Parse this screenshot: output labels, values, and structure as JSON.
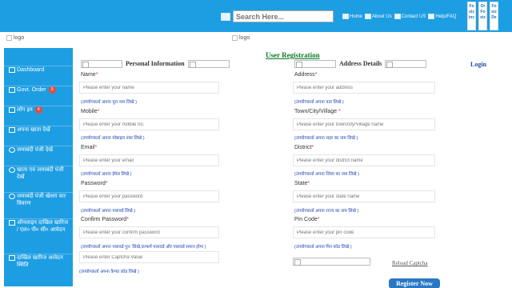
{
  "header": {
    "search_placeholder": "Search Here...",
    "links": [
      "Home",
      "About Us",
      "Contact US",
      "Help/FAQ"
    ],
    "side_tabs": [
      "Fo\nsiz\ninc",
      "Or\nFo\nsiz",
      "Fo\nsiz\nDe"
    ],
    "logo_alt_left": "logo",
    "logo_alt_center": "logo"
  },
  "sidebar": {
    "items": [
      {
        "label": "Dashboard",
        "badge": null,
        "icon": "dashboard-icon"
      },
      {
        "label": "Govt. Order",
        "badge": "3",
        "icon": "document-icon"
      },
      {
        "label": "लॉग इन",
        "badge": "4",
        "icon": "list-icon"
      },
      {
        "label": "अपना खाता देखें",
        "badge": null,
        "icon": "list-icon"
      },
      {
        "label": "जमाबंदी पंजी देखें",
        "badge": null,
        "icon": "eye-icon"
      },
      {
        "label": "खाता एवं जमाबंदी पंजी देखें",
        "badge": null,
        "icon": "eye-icon"
      },
      {
        "label": "जमाबंदी पंजी खेसरा वार विवरण",
        "badge": null,
        "icon": "eye-icon"
      },
      {
        "label": "ऑनलाइन दाखिल खारिज / एल० पी० सी० आवेदन",
        "badge": null,
        "icon": "edit-icon"
      },
      {
        "label": "दाखिल खारिज आवेदन स्थिति",
        "badge": null,
        "icon": "list-icon"
      }
    ]
  },
  "main": {
    "title": "User Registration",
    "login_label": "Login",
    "personal_heading": "Personal Information",
    "address_heading": "Address Details",
    "personal_fields": [
      {
        "label": "Name",
        "placeholder": "Please enter your name",
        "hint": "(उपयोगकर्ता अपना पूरा नाम लिखे )"
      },
      {
        "label": "Mobile",
        "placeholder": "Please enter your mobile no.",
        "hint": "(उपयोगकर्ता अपना मोबाइल नंबर लिखे )"
      },
      {
        "label": "Email",
        "placeholder": "Please enter your email",
        "hint": "(उपयोगकर्ता अपना ईमेल लिखे )"
      },
      {
        "label": "Password",
        "placeholder": "Please enter your password",
        "hint": "(उपयोगकर्ता अपना पासवर्ड लिखे )"
      },
      {
        "label": "Confirm Password",
        "placeholder": "Please enter your confirm password",
        "hint": "(उपयोगकर्ता अपना पासवर्ड पुन: लिखे,कन्फर्म पासवर्ड और पासवर्ड समान होगा )"
      }
    ],
    "address_fields": [
      {
        "label": "Address",
        "placeholder": "Please enter your address",
        "hint": "(उपयोगकर्ता अपना पता लिखे )"
      },
      {
        "label": "Town/City/Village",
        "placeholder": "Please enter your town/city/Village name",
        "hint": "(उपयोगकर्ता अपना शहर का नाम लिखे )"
      },
      {
        "label": "District",
        "placeholder": "Please enter your district name",
        "hint": "(उपयोगकर्ता अपना जिला का नाम लिखे )"
      },
      {
        "label": "State",
        "placeholder": "Please enter your state name",
        "hint": "(उपयोगकर्ता अपना राज्य का नाम लिखे )"
      },
      {
        "label": "Pin Code",
        "placeholder": "Please enter your pin code",
        "hint": "(उपयोगकर्ता अपना पिन कोड लिखे )"
      }
    ],
    "captcha": {
      "placeholder": "Please enter Captcha Value",
      "hint": "(उपयोगकर्ता अपना कैप्चा कोड लिखे )",
      "reload_label": "Reload Captcha"
    },
    "register_label": "Register Now"
  }
}
